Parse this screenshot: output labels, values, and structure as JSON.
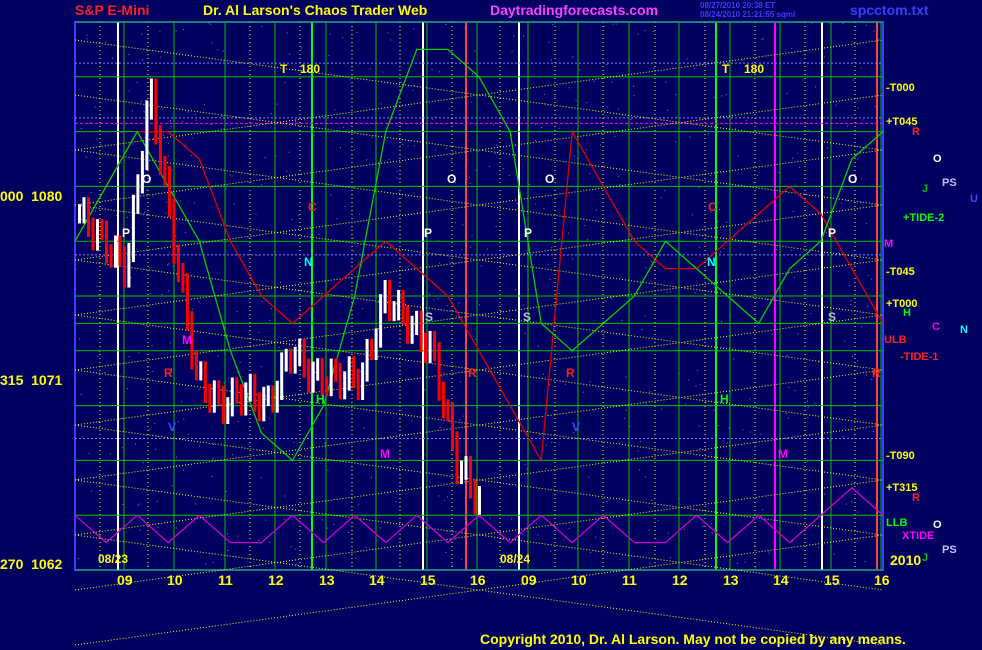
{
  "header": {
    "symbol": "S&P E-Mini",
    "title": "Dr. Al Larson's Chaos Trader Web",
    "site": "Daytradingforecasts.com",
    "stamp1": "08/27/2010 20:38 ET",
    "stamp2": "08/24/2010 21:21:55 sqml",
    "file": "spcctom.txt"
  },
  "colors": {
    "background": "#000060",
    "plot_border": "#3c3cff",
    "grid_green": "#00c000",
    "fan_yellow": "#ffff00",
    "up_bar": "#ffffff",
    "down_bar": "#ff0000",
    "curve_red": "#e00000",
    "curve_green": "#00d000",
    "curve_magenta": "#d000d0"
  },
  "y_labels": [
    {
      "left": "000",
      "price": "1080"
    },
    {
      "left": "315",
      "price": "1071"
    },
    {
      "left": "270",
      "price": "1062"
    }
  ],
  "x_ticks": [
    "09",
    "10",
    "11",
    "12",
    "13",
    "14",
    "15",
    "16",
    "09",
    "10",
    "11",
    "12",
    "13",
    "14",
    "15",
    "16"
  ],
  "date_labels": [
    "08/23",
    "08/24"
  ],
  "year_label": "2010",
  "right_labels": [
    {
      "text": "-T000",
      "color": "#ffff00"
    },
    {
      "text": "+T045",
      "color": "#ffff00"
    },
    {
      "text": "R",
      "color": "#ff2020"
    },
    {
      "text": "O",
      "color": "#ffffff"
    },
    {
      "text": "J",
      "color": "#00c000"
    },
    {
      "text": "PS",
      "color": "#c0c0ff"
    },
    {
      "text": "U",
      "color": "#3050ff"
    },
    {
      "text": "+TIDE-2",
      "color": "#00ff00"
    },
    {
      "text": "M",
      "color": "#ff00ff"
    },
    {
      "text": "-T045",
      "color": "#ffff00"
    },
    {
      "text": "+T000",
      "color": "#ffff00"
    },
    {
      "text": "H",
      "color": "#00ff00"
    },
    {
      "text": "C",
      "color": "#ff00ff"
    },
    {
      "text": "N",
      "color": "#00ffff"
    },
    {
      "text": "ULB",
      "color": "#ff2020"
    },
    {
      "text": "-TIDE-1",
      "color": "#ff2020"
    },
    {
      "text": "-T090",
      "color": "#ffff00"
    },
    {
      "text": "+T315",
      "color": "#ffff00"
    },
    {
      "text": "R",
      "color": "#ff2020"
    },
    {
      "text": "LLB",
      "color": "#00ff00"
    },
    {
      "text": "O",
      "color": "#ffffff"
    },
    {
      "text": "XTIDE",
      "color": "#ff00ff"
    },
    {
      "text": "J",
      "color": "#00c000"
    },
    {
      "text": "PS",
      "color": "#c0c0ff"
    }
  ],
  "markers": [
    {
      "text": "T",
      "color": "#ffff00"
    },
    {
      "text": "180",
      "color": "#ffff00"
    },
    {
      "text": "T",
      "color": "#ffff00"
    },
    {
      "text": "180",
      "color": "#ffff00"
    },
    {
      "text": "O",
      "color": "#ffffff"
    },
    {
      "text": "O",
      "color": "#ffffff"
    },
    {
      "text": "O",
      "color": "#ffffff"
    },
    {
      "text": "O",
      "color": "#ffffff"
    },
    {
      "text": "P",
      "color": "#ffffff"
    },
    {
      "text": "P",
      "color": "#ffffff"
    },
    {
      "text": "P",
      "color": "#ffffff"
    },
    {
      "text": "P",
      "color": "#ffffff"
    },
    {
      "text": "C",
      "color": "#ff2020"
    },
    {
      "text": "C",
      "color": "#ff2020"
    },
    {
      "text": "N",
      "color": "#00ffff"
    },
    {
      "text": "N",
      "color": "#00ffff"
    },
    {
      "text": "S",
      "color": "#c0c0c0"
    },
    {
      "text": "S",
      "color": "#c0c0c0"
    },
    {
      "text": "S",
      "color": "#c0c0c0"
    },
    {
      "text": "M",
      "color": "#ff00ff"
    },
    {
      "text": "M",
      "color": "#ff00ff"
    },
    {
      "text": "M",
      "color": "#ff00ff"
    },
    {
      "text": "R",
      "color": "#ff2020"
    },
    {
      "text": "R",
      "color": "#ff2020"
    },
    {
      "text": "R",
      "color": "#ff2020"
    },
    {
      "text": "R",
      "color": "#ff2020"
    },
    {
      "text": "V",
      "color": "#3050ff"
    },
    {
      "text": "V",
      "color": "#3050ff"
    },
    {
      "text": "H",
      "color": "#00ff00"
    },
    {
      "text": "H",
      "color": "#00ff00"
    }
  ],
  "footer": {
    "copyright": "Copyright 2010, Dr. Al Larson. May not be copied by any means."
  },
  "chart_data": {
    "type": "bar",
    "title": "S&P E-Mini",
    "ylim": [
      1062,
      1082
    ],
    "y_ticks": [
      1062,
      1071,
      1080
    ],
    "sessions": [
      {
        "date": "08/23",
        "hours": [
          "09",
          "10",
          "11",
          "12",
          "13",
          "14",
          "15",
          "16"
        ]
      },
      {
        "date": "08/24",
        "hours": [
          "09",
          "10",
          "11",
          "12",
          "13",
          "14",
          "15",
          "16"
        ]
      }
    ],
    "price_close_approx": {
      "08/23": [
        1075,
        1074,
        1073,
        1079.5,
        1074,
        1069,
        1068,
        1068.5,
        1068,
        1070,
        1069,
        1069,
        1069,
        1072,
        1071,
        1070,
        1066,
        1064.5
      ],
      "08/24": []
    },
    "series": [
      {
        "name": "-TIDE-1",
        "values": [
          1074,
          1076,
          1078,
          1078,
          1077,
          1074,
          1072,
          1071,
          1072,
          1073,
          1074,
          1073,
          1072,
          1070,
          1068,
          1066,
          1078,
          1076,
          1074,
          1073,
          1073,
          1074,
          1075,
          1076,
          1075,
          1073,
          1071
        ]
      },
      {
        "name": "+TIDE-2",
        "values": [
          1074,
          1076,
          1078,
          1076,
          1074,
          1070,
          1067,
          1066,
          1068,
          1072,
          1078,
          1081,
          1081,
          1080,
          1078,
          1071,
          1070,
          1071,
          1072,
          1074,
          1073,
          1072,
          1071,
          1073,
          1074,
          1077,
          1078
        ]
      },
      {
        "name": "XTIDE",
        "values": [
          1064,
          1063,
          1064,
          1063,
          1064,
          1063,
          1063,
          1064,
          1063,
          1064,
          1063,
          1064,
          1063,
          1064,
          1063,
          1064,
          1063,
          1064,
          1063,
          1063,
          1064,
          1063,
          1064,
          1063,
          1064,
          1065,
          1064
        ]
      }
    ]
  }
}
